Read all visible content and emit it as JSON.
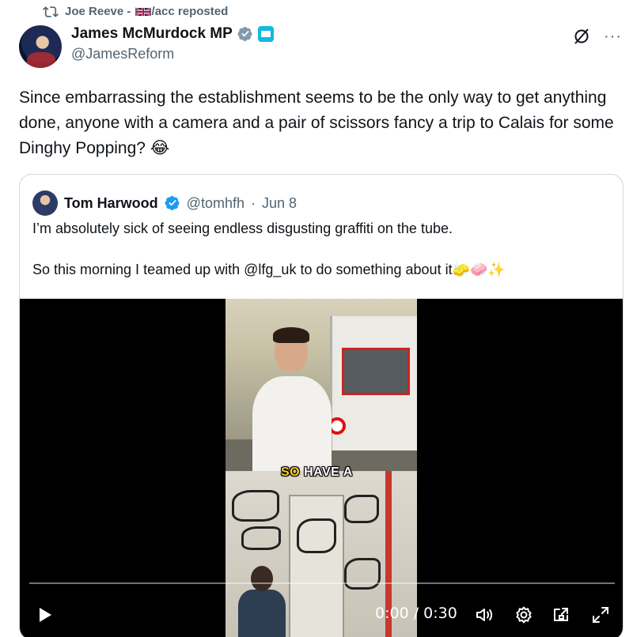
{
  "repost": {
    "icon": "repost-icon",
    "name": "Joe Reeve - ",
    "flag": "uk-flag",
    "suffix": "/acc reposted"
  },
  "author": {
    "name": "James McMurdock MP",
    "handle": "@JamesReform",
    "verified_icon": "verified-badge-icon",
    "affiliation_icon": "affiliation-badge-icon"
  },
  "actions": {
    "grok_icon": "grok-icon",
    "more_label": "···"
  },
  "tweet": {
    "text": "Since embarrassing the establishment seems to be the only way to get anything done, anyone with a camera and a pair of scissors fancy a trip to Calais for some Dinghy Popping? 😂"
  },
  "quote": {
    "name": "Tom Harwood",
    "handle": "@tomhfh",
    "separator": "·",
    "date": "Jun 8",
    "line1": "I’m absolutely sick of seeing endless disgusting graffiti on the tube.",
    "line2": "So this morning I teamed up with @lfg_uk to do something about it🧽🧼✨"
  },
  "video": {
    "caption_highlight": "SO",
    "caption_rest": " HAVE A",
    "time": "0:00 / 0:30",
    "controls": [
      "play-icon",
      "volume-icon",
      "settings-icon",
      "pip-icon",
      "fullscreen-icon"
    ]
  },
  "colors": {
    "text": "#0f1419",
    "muted": "#536471",
    "verified": "#1d9bf0",
    "border": "#cfd9de"
  }
}
